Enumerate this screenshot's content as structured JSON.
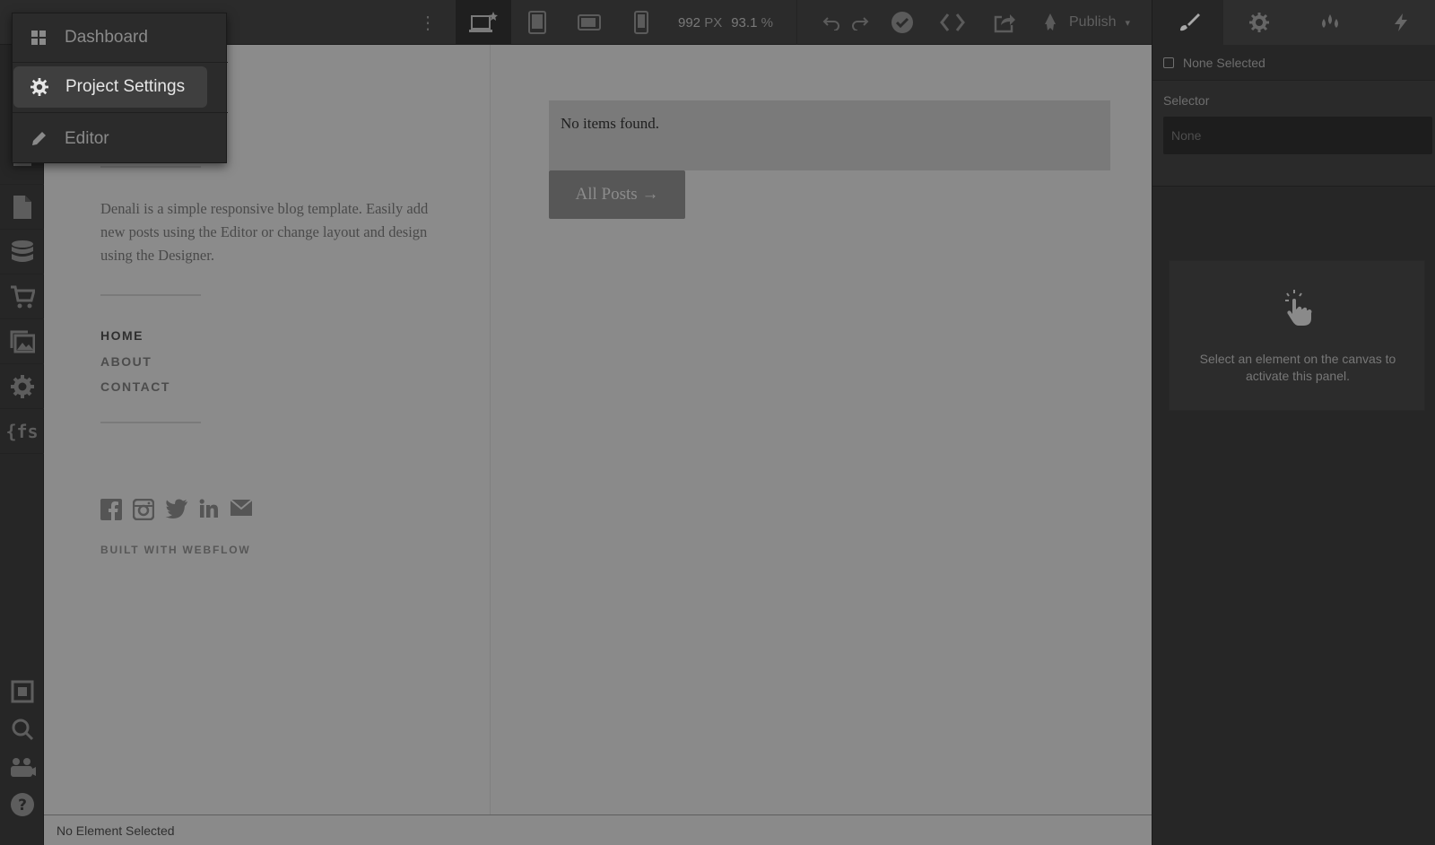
{
  "menu": {
    "items": [
      {
        "label": "Dashboard",
        "icon": "dashboard-grid-icon"
      },
      {
        "label": "Project Settings",
        "icon": "gear-icon"
      },
      {
        "label": "Editor",
        "icon": "pencil-icon"
      }
    ],
    "active": "Project Settings"
  },
  "toolbar": {
    "width_value": "992",
    "width_unit": "PX",
    "zoom_value": "93.1",
    "zoom_unit": "%",
    "publish_label": "Publish"
  },
  "right_panel": {
    "tabs": [
      "style-brush-icon",
      "settings-gear-icon",
      "drops-icon",
      "interactions-bolt-icon"
    ],
    "none_selected": "None Selected",
    "selector_label": "Selector",
    "selector_placeholder": "None",
    "hint": "Select an element on the canvas to activate this panel."
  },
  "left_rail": {
    "icons": [
      "navigator-icon",
      "pages-icon",
      "cms-database-icon",
      "ecommerce-cart-icon",
      "assets-images-icon",
      "settings-gear-icon",
      "finsweet-fs-icon",
      "frame-icon",
      "search-icon",
      "users-icon",
      "help-icon"
    ],
    "fs_label": "{fs"
  },
  "canvas": {
    "intro": "Denali is a simple responsive blog template. Easily add new posts using the Editor or change layout and design using the Designer.",
    "nav": [
      "HOME",
      "ABOUT",
      "CONTACT"
    ],
    "social_icons": [
      "facebook-icon",
      "instagram-icon",
      "twitter-icon",
      "linkedin-icon",
      "email-icon"
    ],
    "built_with": "BUILT WITH WEBFLOW",
    "empty_state": "No items found.",
    "all_posts_button": "All Posts →"
  },
  "status_bar": {
    "text": "No Element Selected"
  },
  "colors": {
    "canvas_overlay": "#8a8a8a",
    "panel_bg": "#262626",
    "menu_active_bg": "#3f3f3f"
  }
}
